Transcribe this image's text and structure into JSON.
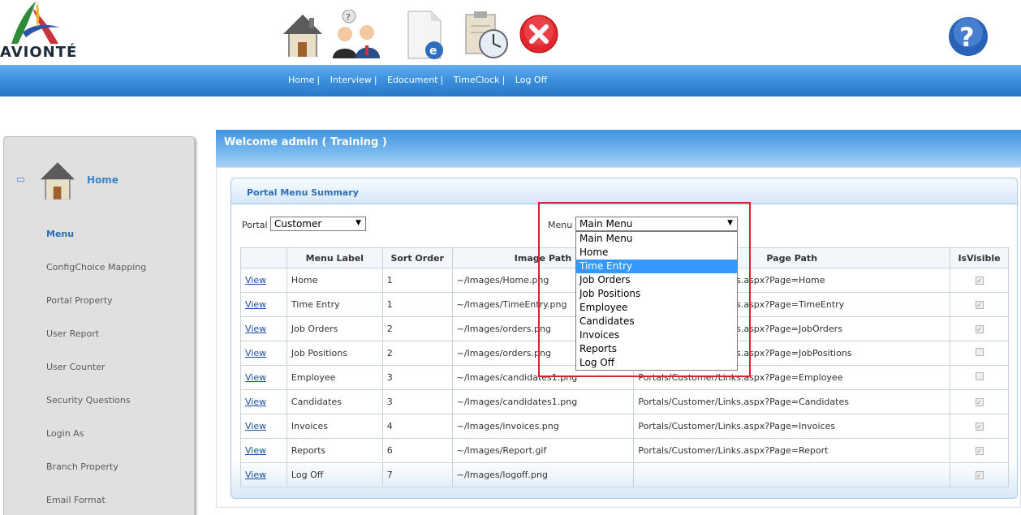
{
  "brand": {
    "logo_text": "AVIONTÉ"
  },
  "nav": {
    "items": [
      "Home",
      "Interview",
      "Edocument",
      "TimeClock",
      "Log Off"
    ],
    "separator": "|"
  },
  "icons": [
    "home-icon",
    "interview-icon",
    "edocument-icon",
    "timeclock-icon",
    "logoff-icon",
    "help-icon"
  ],
  "sidebar": {
    "home_label": "Home",
    "items": [
      {
        "label": "Menu",
        "active": true
      },
      {
        "label": "ConfigChoice Mapping"
      },
      {
        "label": "Portal Property"
      },
      {
        "label": "User Report"
      },
      {
        "label": "User Counter"
      },
      {
        "label": "Security Questions"
      },
      {
        "label": "Login As"
      },
      {
        "label": "Branch Property"
      },
      {
        "label": "Email Format"
      }
    ]
  },
  "welcome": "Welcome admin ( Training )",
  "summary": {
    "title": "Portal Menu Summary",
    "portal_label": "Portal",
    "portal_value": "Customer",
    "menu_label": "Menu",
    "menu_value": "Main Menu",
    "menu_options": [
      "Main Menu",
      "Home",
      "Time Entry",
      "Job Orders",
      "Job Positions",
      "Employee",
      "Candidates",
      "Invoices",
      "Reports",
      "Log Off"
    ],
    "menu_highlighted": "Time Entry"
  },
  "table": {
    "headers": [
      "",
      "Menu Label",
      "Sort Order",
      "Image Path",
      "Page Path",
      "IsVisible"
    ],
    "view_label": "View",
    "rows": [
      {
        "label": "Home",
        "sort": "1",
        "image": "~/Images/Home.png",
        "page": "Portals/Customer/Links.aspx?Page=Home",
        "visible": true
      },
      {
        "label": "Time Entry",
        "sort": "1",
        "image": "~/Images/TimeEntry.png",
        "page": "Portals/Customer/Links.aspx?Page=TimeEntry",
        "visible": true
      },
      {
        "label": "Job Orders",
        "sort": "2",
        "image": "~/Images/orders.png",
        "page": "Portals/Customer/Links.aspx?Page=JobOrders",
        "visible": true
      },
      {
        "label": "Job Positions",
        "sort": "2",
        "image": "~/Images/orders.png",
        "page": "Portals/Customer/Links.aspx?Page=JobPositions",
        "visible": false
      },
      {
        "label": "Employee",
        "sort": "3",
        "image": "~/Images/candidates1.png",
        "page": "Portals/Customer/Links.aspx?Page=Employee",
        "visible": false
      },
      {
        "label": "Candidates",
        "sort": "3",
        "image": "~/Images/candidates1.png",
        "page": "Portals/Customer/Links.aspx?Page=Candidates",
        "visible": true
      },
      {
        "label": "Invoices",
        "sort": "4",
        "image": "~/Images/invoices.png",
        "page": "Portals/Customer/Links.aspx?Page=Invoices",
        "visible": true
      },
      {
        "label": "Reports",
        "sort": "6",
        "image": "~/Images/Report.gif",
        "page": "Portals/Customer/Links.aspx?Page=Report",
        "visible": true
      },
      {
        "label": "Log Off",
        "sort": "7",
        "image": "~/Images/logoff.png",
        "page": "",
        "visible": true
      }
    ]
  },
  "colors": {
    "accent": "#3a8fdc",
    "highlight_border": "#d9242e",
    "selected_option": "#3399ff"
  }
}
